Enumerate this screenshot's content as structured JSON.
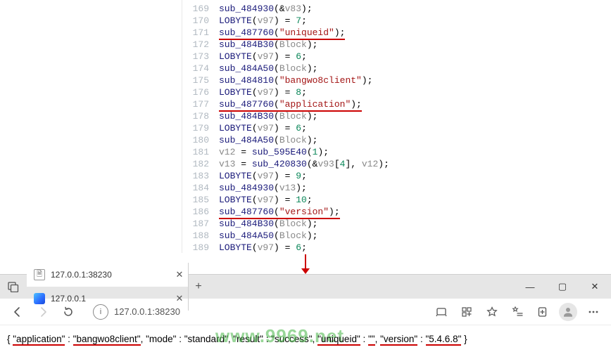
{
  "code": {
    "lines": [
      {
        "n": 169,
        "seg": [
          [
            "fn",
            "sub_484930"
          ],
          [
            "op",
            "(&"
          ],
          [
            "id",
            "v83"
          ],
          [
            "op",
            ");"
          ]
        ]
      },
      {
        "n": 170,
        "seg": [
          [
            "fn",
            "LOBYTE"
          ],
          [
            "op",
            "("
          ],
          [
            "id",
            "v97"
          ],
          [
            "op",
            ") = "
          ],
          [
            "num",
            "7"
          ],
          [
            "op",
            ";"
          ]
        ]
      },
      {
        "n": 171,
        "ul": true,
        "seg": [
          [
            "fn",
            "sub_487760"
          ],
          [
            "op",
            "("
          ],
          [
            "str",
            "\"uniqueid\""
          ],
          [
            "op",
            ");"
          ]
        ]
      },
      {
        "n": 172,
        "seg": [
          [
            "fn",
            "sub_484B30"
          ],
          [
            "op",
            "("
          ],
          [
            "id",
            "Block"
          ],
          [
            "op",
            ");"
          ]
        ]
      },
      {
        "n": 173,
        "seg": [
          [
            "fn",
            "LOBYTE"
          ],
          [
            "op",
            "("
          ],
          [
            "id",
            "v97"
          ],
          [
            "op",
            ") = "
          ],
          [
            "num",
            "6"
          ],
          [
            "op",
            ";"
          ]
        ]
      },
      {
        "n": 174,
        "seg": [
          [
            "fn",
            "sub_484A50"
          ],
          [
            "op",
            "("
          ],
          [
            "id",
            "Block"
          ],
          [
            "op",
            ");"
          ]
        ]
      },
      {
        "n": 175,
        "seg": [
          [
            "fn",
            "sub_484810"
          ],
          [
            "op",
            "("
          ],
          [
            "str",
            "\"bangwo8client\""
          ],
          [
            "op",
            ");"
          ]
        ]
      },
      {
        "n": 176,
        "seg": [
          [
            "fn",
            "LOBYTE"
          ],
          [
            "op",
            "("
          ],
          [
            "id",
            "v97"
          ],
          [
            "op",
            ") = "
          ],
          [
            "num",
            "8"
          ],
          [
            "op",
            ";"
          ]
        ]
      },
      {
        "n": 177,
        "ul": true,
        "seg": [
          [
            "fn",
            "sub_487760"
          ],
          [
            "op",
            "("
          ],
          [
            "str",
            "\"application\""
          ],
          [
            "op",
            ");"
          ]
        ]
      },
      {
        "n": 178,
        "seg": [
          [
            "fn",
            "sub_484B30"
          ],
          [
            "op",
            "("
          ],
          [
            "id",
            "Block"
          ],
          [
            "op",
            ");"
          ]
        ]
      },
      {
        "n": 179,
        "seg": [
          [
            "fn",
            "LOBYTE"
          ],
          [
            "op",
            "("
          ],
          [
            "id",
            "v97"
          ],
          [
            "op",
            ") = "
          ],
          [
            "num",
            "6"
          ],
          [
            "op",
            ";"
          ]
        ]
      },
      {
        "n": 180,
        "seg": [
          [
            "fn",
            "sub_484A50"
          ],
          [
            "op",
            "("
          ],
          [
            "id",
            "Block"
          ],
          [
            "op",
            ");"
          ]
        ]
      },
      {
        "n": 181,
        "seg": [
          [
            "id",
            "v12"
          ],
          [
            "op",
            " = "
          ],
          [
            "fn",
            "sub_595E40"
          ],
          [
            "op",
            "("
          ],
          [
            "num",
            "1"
          ],
          [
            "op",
            ");"
          ]
        ]
      },
      {
        "n": 182,
        "seg": [
          [
            "id",
            "v13"
          ],
          [
            "op",
            " = "
          ],
          [
            "fn",
            "sub_420830"
          ],
          [
            "op",
            "(&"
          ],
          [
            "id",
            "v93"
          ],
          [
            "op",
            "["
          ],
          [
            "num",
            "4"
          ],
          [
            "op",
            "], "
          ],
          [
            "id",
            "v12"
          ],
          [
            "op",
            ");"
          ]
        ]
      },
      {
        "n": 183,
        "seg": [
          [
            "fn",
            "LOBYTE"
          ],
          [
            "op",
            "("
          ],
          [
            "id",
            "v97"
          ],
          [
            "op",
            ") = "
          ],
          [
            "num",
            "9"
          ],
          [
            "op",
            ";"
          ]
        ]
      },
      {
        "n": 184,
        "seg": [
          [
            "fn",
            "sub_484930"
          ],
          [
            "op",
            "("
          ],
          [
            "id",
            "v13"
          ],
          [
            "op",
            ");"
          ]
        ]
      },
      {
        "n": 185,
        "seg": [
          [
            "fn",
            "LOBYTE"
          ],
          [
            "op",
            "("
          ],
          [
            "id",
            "v97"
          ],
          [
            "op",
            ") = "
          ],
          [
            "num",
            "10"
          ],
          [
            "op",
            ";"
          ]
        ]
      },
      {
        "n": 186,
        "ul": true,
        "seg": [
          [
            "fn",
            "sub_487760"
          ],
          [
            "op",
            "("
          ],
          [
            "str",
            "\"version\""
          ],
          [
            "op",
            ");"
          ]
        ]
      },
      {
        "n": 187,
        "seg": [
          [
            "fn",
            "sub_484B30"
          ],
          [
            "op",
            "("
          ],
          [
            "id",
            "Block"
          ],
          [
            "op",
            ");"
          ]
        ]
      },
      {
        "n": 188,
        "seg": [
          [
            "fn",
            "sub_484A50"
          ],
          [
            "op",
            "("
          ],
          [
            "id",
            "Block"
          ],
          [
            "op",
            ");"
          ]
        ]
      },
      {
        "n": 189,
        "seg": [
          [
            "fn",
            "LOBYTE"
          ],
          [
            "op",
            "("
          ],
          [
            "id",
            "v97"
          ],
          [
            "op",
            ") = "
          ],
          [
            "num",
            "6"
          ],
          [
            "op",
            ";"
          ]
        ]
      }
    ]
  },
  "browser": {
    "tabs": [
      {
        "title": "127.0.0.1:38230",
        "active": true,
        "icon": "doc"
      },
      {
        "title": "127.0.0.1",
        "active": false,
        "icon": "edge"
      }
    ],
    "newtab_glyph": "+",
    "address_url": "127.0.0.1:38230",
    "window_controls": {
      "min": "—",
      "max": "▢",
      "close": "✕"
    },
    "json_output": {
      "open": "{ ",
      "close": " }",
      "pairs": [
        {
          "k": "\"application\"",
          "v": "\"bangwo8client\"",
          "ul": true
        },
        {
          "k": "\"mode\"",
          "v": "\"standard\"",
          "ul": false
        },
        {
          "k": "\"result\"",
          "v": "\"success\"",
          "ul": false
        },
        {
          "k": "\"uniqueid\"",
          "v": "\"\"",
          "ul": true
        },
        {
          "k": "\"version\"",
          "v": "\"5.4.6.8\"",
          "ul": true
        }
      ]
    },
    "watermark": "www.9969.net"
  }
}
